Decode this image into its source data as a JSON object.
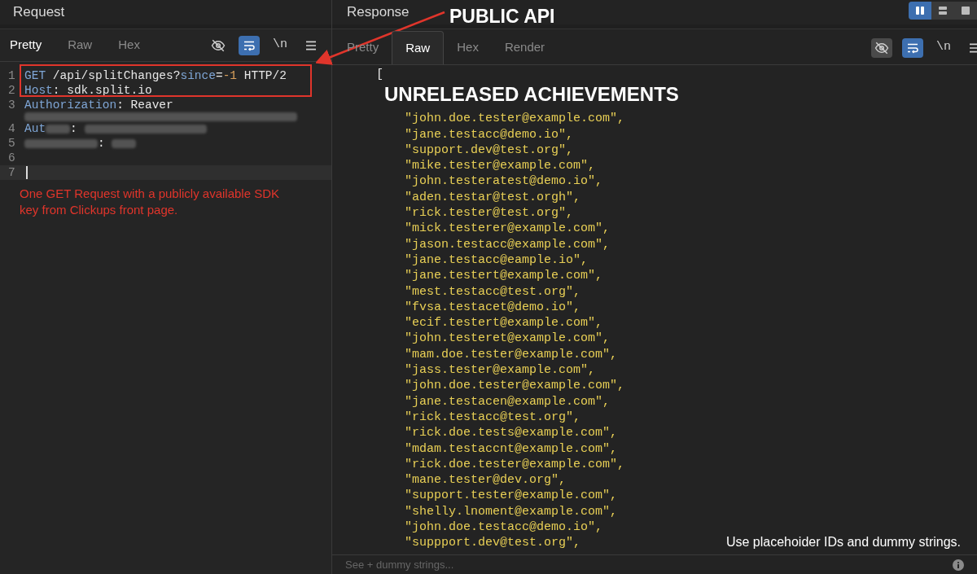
{
  "request": {
    "title": "Request",
    "tabs": [
      {
        "label": "Pretty",
        "selected": true
      },
      {
        "label": "Raw",
        "selected": false
      },
      {
        "label": "Hex",
        "selected": false
      }
    ],
    "toolbar": [
      {
        "kind": "hide",
        "active": false
      },
      {
        "kind": "wrap",
        "active": true
      },
      {
        "kind": "newline",
        "label": "\\n",
        "active": false
      },
      {
        "kind": "menu",
        "active": false
      }
    ],
    "lines": [
      {
        "number": "1",
        "tokens": [
          {
            "kind": "key",
            "text": "GET"
          },
          {
            "kind": "plain",
            "text": " /api/splitChanges?"
          },
          {
            "kind": "key",
            "text": "since"
          },
          {
            "kind": "plain",
            "text": "="
          },
          {
            "kind": "number",
            "text": "-1"
          },
          {
            "kind": "plain",
            "text": " HTTP/2"
          }
        ]
      },
      {
        "number": "2",
        "tokens": [
          {
            "kind": "key",
            "text": "Host"
          },
          {
            "kind": "plain",
            "text": ": sdk.split.io"
          }
        ]
      },
      {
        "number": "3",
        "tokens": [
          {
            "kind": "key",
            "text": "Authorization"
          },
          {
            "kind": "plain",
            "text": ": Reaver"
          },
          {
            "kind": "break"
          },
          {
            "kind": "redacted"
          }
        ]
      },
      {
        "number": "4",
        "tokens": [
          {
            "kind": "key",
            "text": "Aut"
          },
          {
            "kind": "redacted"
          },
          {
            "kind": "plain",
            "text": ": "
          },
          {
            "kind": "redacted"
          }
        ]
      },
      {
        "number": "5",
        "tokens": [
          {
            "kind": "redacted"
          },
          {
            "kind": "plain",
            "text": ": "
          },
          {
            "kind": "redacted"
          }
        ]
      },
      {
        "number": "6"
      },
      {
        "number": "7",
        "current": true
      }
    ]
  },
  "response": {
    "title": "Response",
    "layout_buttons": [
      {
        "kind": "columns",
        "selected": true
      },
      {
        "kind": "rows",
        "selected": false
      },
      {
        "kind": "single",
        "selected": false
      }
    ],
    "tabs": [
      {
        "label": "Pretty",
        "selected": false
      },
      {
        "label": "Raw",
        "selected": true
      },
      {
        "label": "Hex",
        "selected": false
      },
      {
        "label": "Render",
        "selected": false
      }
    ],
    "toolbar": [
      {
        "kind": "hide",
        "active": false
      },
      {
        "kind": "wrap",
        "active": true
      },
      {
        "kind": "newline",
        "label": "\\n",
        "active": false
      },
      {
        "kind": "menu",
        "active": false
      }
    ],
    "open_bracket": "[",
    "emails": [
      "\"john.doe.tester@example.com\",",
      "\"jane.testacc@demo.io\",",
      "\"support.dev@test.org\",",
      "\"mike.tester@example.com\",",
      "\"john.testeratest@demo.io\",",
      "\"aden.testar@test.orgh\",",
      "\"rick.tester@test.org\",",
      "\"mick.testerer@example.com\",",
      "\"jason.testacc@example.com\",",
      "\"jane.testacc@eample.io\",",
      "\"jane.testert@example.com\",",
      "\"mest.testacc@test.org\",",
      "\"fvsa.testacet@demo.io\",",
      "\"ecif.testert@example.com\",",
      "\"john.testeret@example.com\",",
      "\"mam.doe.tester@example.com\",",
      "\"jass.tester@example.com\",",
      "\"john.doe.tester@example.com\",",
      "\"jane.testacen@example.com\",",
      "\"rick.testacc@test.org\",",
      "\"rick.doe.tests@example.com\",",
      "\"mdam.testaccnt@example.com\",",
      "\"rick.doe.tester@example.com\",",
      "\"mane.tester@dev.org\",",
      "\"support.tester@example.com\",",
      "\"shelly.lnoment@example.com\",",
      "\"john.doe.testacc@demo.io\",",
      "\"suppport.dev@test.org\","
    ],
    "search": {
      "placeholder": "See + dummy strings..."
    }
  },
  "annotations": {
    "public_api": "PUBLIC API",
    "unreleased": "UNRELEASED ACHIEVEMENTS",
    "note": "One GET Request with a publicly available SDK key from Clickups front page.",
    "footer_note": "Use placehoider IDs and dummy strings."
  }
}
